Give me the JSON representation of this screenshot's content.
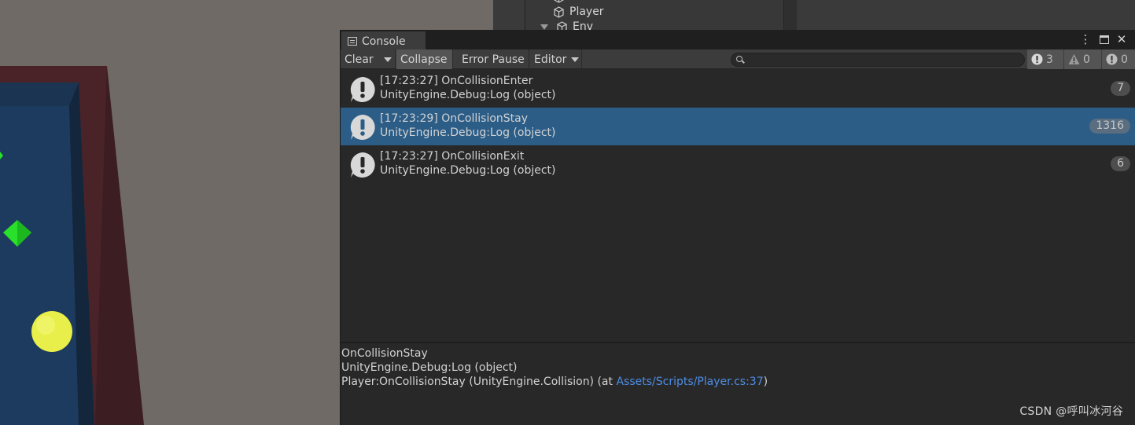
{
  "hierarchy": {
    "items": [
      {
        "label": "Player",
        "icon": "cube-icon"
      },
      {
        "label": "Env",
        "icon": "cube-icon",
        "expanded": true
      }
    ]
  },
  "console": {
    "tab_title": "Console",
    "toolbar": {
      "clear_label": "Clear",
      "collapse_label": "Collapse",
      "error_pause_label": "Error Pause",
      "editor_label": "Editor",
      "search_placeholder": "",
      "info_count": "3",
      "warning_count": "0",
      "error_count": "0"
    },
    "logs": [
      {
        "line1": "[17:23:27] OnCollisionEnter",
        "line2": "UnityEngine.Debug:Log (object)",
        "count": "7",
        "selected": false
      },
      {
        "line1": "[17:23:29] OnCollisionStay",
        "line2": "UnityEngine.Debug:Log (object)",
        "count": "1316",
        "selected": true
      },
      {
        "line1": "[17:23:27] OnCollisionExit",
        "line2": "UnityEngine.Debug:Log (object)",
        "count": "6",
        "selected": false
      }
    ],
    "detail": {
      "line1": "OnCollisionStay",
      "line2": "UnityEngine.Debug:Log (object)",
      "line3_prefix": "Player:OnCollisionStay (UnityEngine.Collision) (at ",
      "line3_link": "Assets/Scripts/Player.cs:37",
      "line3_suffix": ")"
    }
  },
  "watermark": "CSDN @呼叫冰河谷",
  "colors": {
    "selected_row": "#2c5d87",
    "link": "#4d8ee6",
    "panel_bg": "#282828",
    "toolbar_bg": "#3c3c3c"
  }
}
